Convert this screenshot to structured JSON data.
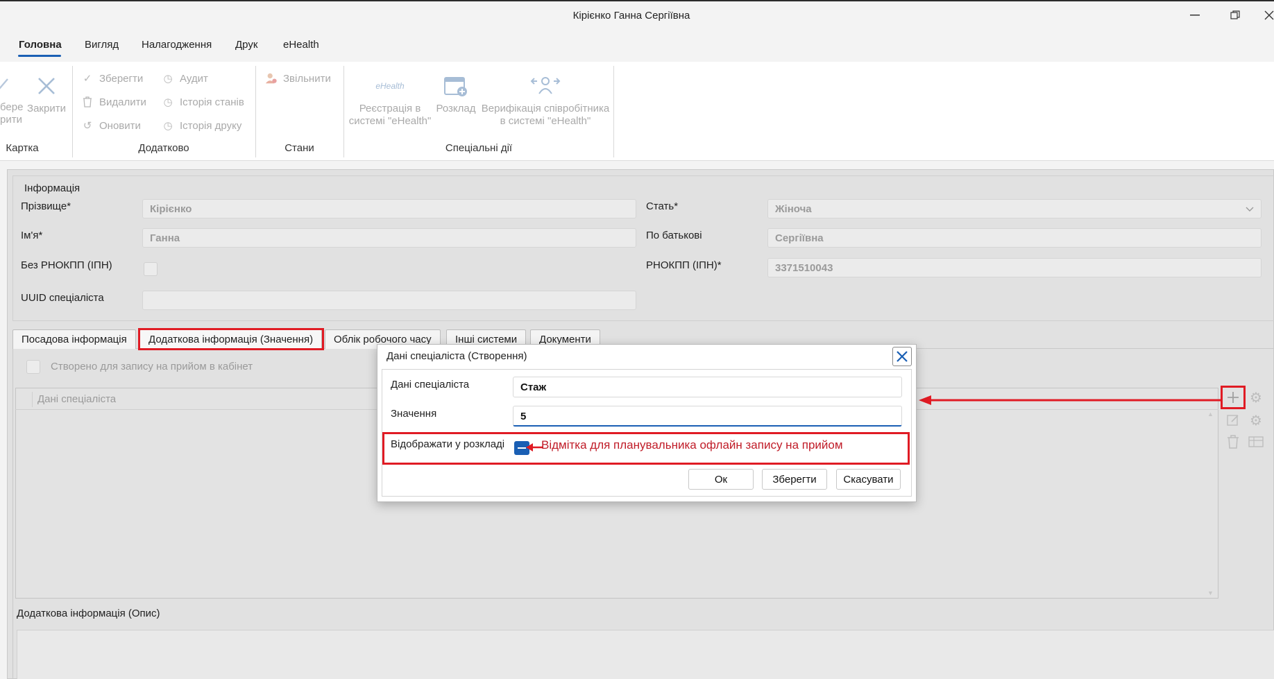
{
  "window": {
    "title": "Кірієнко Ганна Сергіївна"
  },
  "menu": {
    "tabs": [
      {
        "label": "Головна",
        "active": true
      },
      {
        "label": "Вигляд"
      },
      {
        "label": "Налагодження"
      },
      {
        "label": "Друк"
      },
      {
        "label": "eHealth"
      }
    ]
  },
  "ribbon": {
    "card": {
      "save_label": "берегти\nрити",
      "save_partial_1": "берегти",
      "save_partial_2": "рити",
      "close_label": "Закрити",
      "group": "Картка"
    },
    "extra": {
      "save": "Зберегти",
      "delete": "Видалити",
      "refresh": "Оновити",
      "audit": "Аудит",
      "state_history": "Історія станів",
      "print_history": "Історія друку",
      "group": "Додатково"
    },
    "states": {
      "dismiss": "Звільнити",
      "group": "Стани"
    },
    "special": {
      "ehealth_logo": "eHealth",
      "register_1": "Реєстрація в",
      "register_2": "системі \"eHealth\"",
      "schedule": "Розклад",
      "verify_1": "Верифікація співробітника",
      "verify_2": "в системі \"eHealth\"",
      "group": "Спеціальні дії"
    }
  },
  "info": {
    "section_title": "Інформація",
    "surname_label": "Прізвище*",
    "surname_value": "Кірієнко",
    "name_label": "Ім'я*",
    "name_value": "Ганна",
    "no_rnokpp_label": "Без РНОКПП (ІПН)",
    "uuid_label": "UUID спеціаліста",
    "uuid_value": "",
    "gender_label": "Стать*",
    "gender_value": "Жіноча",
    "patronymic_label": "По батькові",
    "patronymic_value": "Сергіївна",
    "rnokpp_label": "РНОКПП (ІПН)*",
    "rnokpp_value": "3371510043"
  },
  "form_tabs": [
    {
      "label": "Посадова інформація"
    },
    {
      "label": "Додаткова інформація (Значення)",
      "active": true
    },
    {
      "label": "Облік робочого часу"
    },
    {
      "label": "Інші системи"
    },
    {
      "label": "Документи"
    }
  ],
  "tab_content": {
    "created_for_booking_label": "Створено для запису на прийом в кабінет",
    "grid_column": "Дані спеціаліста",
    "desc_label": "Додаткова інформація (Опис)"
  },
  "dialog": {
    "title": "Дані спеціаліста (Створення)",
    "data_label": "Дані спеціаліста",
    "data_value": "Стаж",
    "value_label": "Значення",
    "value_value": "5",
    "show_in_schedule_label": "Відображати у розкладі",
    "show_in_schedule_checked": true,
    "ok": "Ок",
    "save": "Зберегти",
    "cancel": "Скасувати"
  },
  "annotation": {
    "text": "Відмітка для планувальника офлайн запису на прийом",
    "color": "#e01b24"
  },
  "colors": {
    "accent": "#1a5fb4",
    "annotation_red": "#e01b24"
  }
}
